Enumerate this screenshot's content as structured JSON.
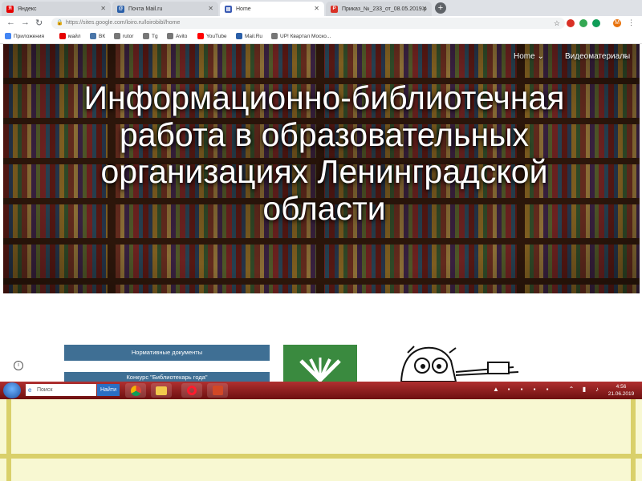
{
  "browser": {
    "tabs": [
      {
        "label": "Яндекс",
        "color": "#e60000"
      },
      {
        "label": "Почта Mail.ru",
        "color": "#2a5fa8"
      },
      {
        "label": "Home",
        "color": "#3b5bb5"
      },
      {
        "label": "Приказ_№_233_от_08.05.2019.p",
        "color": "#d93025"
      }
    ],
    "url": "https://sites.google.com/loiro.ru/loirobibl/home",
    "bookmarks": [
      {
        "label": "Приложения",
        "color": "#4285f4"
      },
      {
        "label": "майл",
        "color": "#e60000"
      },
      {
        "label": "ВК",
        "color": "#4a76a8"
      },
      {
        "label": "rutor",
        "color": "#777777"
      },
      {
        "label": "Tg",
        "color": "#777777"
      },
      {
        "label": "Avito",
        "color": "#777777"
      },
      {
        "label": "YouTube",
        "color": "#ff0000"
      },
      {
        "label": "Mail.Ru",
        "color": "#2a5fa8"
      },
      {
        "label": "UP! Квартал Моско...",
        "color": "#777777"
      }
    ],
    "profile_letter": "M"
  },
  "site": {
    "nav": {
      "home": "Home",
      "videos": "Видеоматериалы"
    },
    "hero_title": "Информационно-библиотечная работа в образовательных организациях Ленинградской области",
    "buttons": [
      "Нормативные документы",
      "Конкурс \"Библиотекарь года\""
    ]
  },
  "taskbar": {
    "search_placeholder": "Поиск",
    "search_button": "Найти",
    "time": "4:56",
    "date": "21.06.2019"
  }
}
